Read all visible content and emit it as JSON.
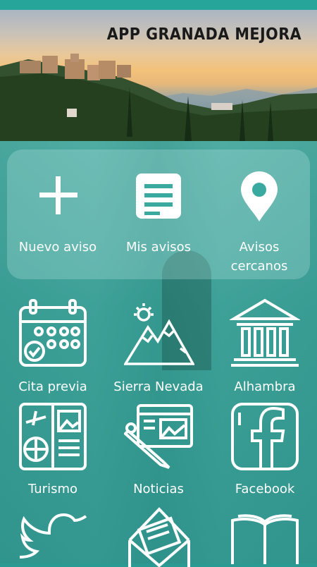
{
  "header": {
    "title": "APP GRANADA MEJORA"
  },
  "quick_actions": [
    {
      "label": "Nuevo aviso",
      "icon": "plus-icon"
    },
    {
      "label": "Mis avisos",
      "icon": "list-icon"
    },
    {
      "label_line1": "Avisos",
      "label_line2": "cercanos",
      "icon": "location-pin-icon"
    }
  ],
  "grid": [
    {
      "label": "Cita previa",
      "icon": "calendar-icon"
    },
    {
      "label": "Sierra Nevada",
      "icon": "mountain-icon"
    },
    {
      "label": "Alhambra",
      "icon": "monument-icon"
    },
    {
      "label": "Turismo",
      "icon": "travel-brochure-icon"
    },
    {
      "label": "Noticias",
      "icon": "news-icon"
    },
    {
      "label": "Facebook",
      "icon": "facebook-icon"
    },
    {
      "label": "",
      "icon": "twitter-icon"
    },
    {
      "label": "",
      "icon": "mail-icon"
    },
    {
      "label": "",
      "icon": "book-icon"
    }
  ],
  "colors": {
    "accent": "#26a69a",
    "icon": "#ffffff"
  }
}
